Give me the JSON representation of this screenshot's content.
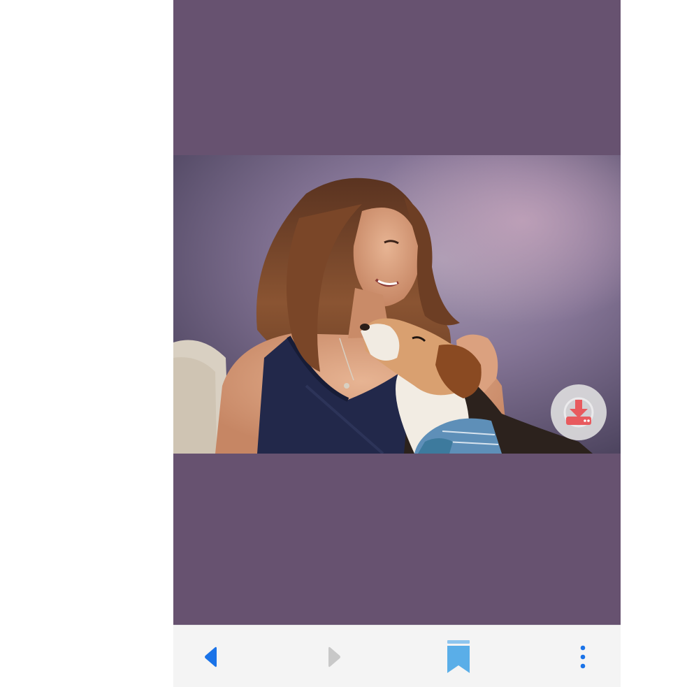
{
  "viewer": {
    "background_color": "#675270",
    "photo": {
      "subject": "woman-with-beagle-portrait"
    },
    "download_button": {
      "icon": "download-icon",
      "icon_color": "#e85a5e"
    }
  },
  "toolbar": {
    "background_color": "#f4f4f4",
    "accent_color": "#1a73e8",
    "disabled_color": "#c8c8c8",
    "items": [
      {
        "icon": "back-arrow-icon",
        "enabled": true
      },
      {
        "icon": "forward-arrow-icon",
        "enabled": false
      },
      {
        "icon": "bookmark-icon",
        "enabled": true
      },
      {
        "icon": "more-vertical-icon",
        "enabled": true
      }
    ]
  }
}
